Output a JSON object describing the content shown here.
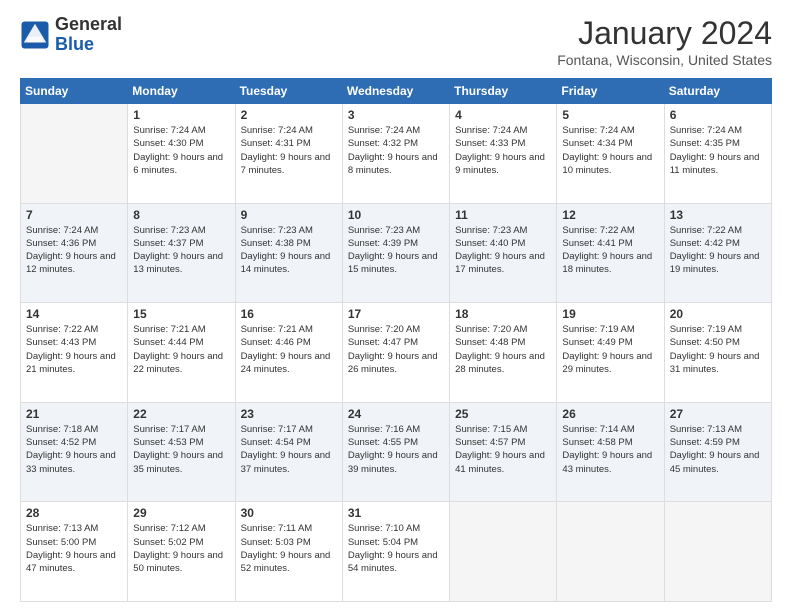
{
  "header": {
    "logo_general": "General",
    "logo_blue": "Blue",
    "month_title": "January 2024",
    "location": "Fontana, Wisconsin, United States"
  },
  "days_of_week": [
    "Sunday",
    "Monday",
    "Tuesday",
    "Wednesday",
    "Thursday",
    "Friday",
    "Saturday"
  ],
  "weeks": [
    {
      "shaded": false,
      "days": [
        {
          "num": "",
          "sunrise": "",
          "sunset": "",
          "daylight": ""
        },
        {
          "num": "1",
          "sunrise": "Sunrise: 7:24 AM",
          "sunset": "Sunset: 4:30 PM",
          "daylight": "Daylight: 9 hours and 6 minutes."
        },
        {
          "num": "2",
          "sunrise": "Sunrise: 7:24 AM",
          "sunset": "Sunset: 4:31 PM",
          "daylight": "Daylight: 9 hours and 7 minutes."
        },
        {
          "num": "3",
          "sunrise": "Sunrise: 7:24 AM",
          "sunset": "Sunset: 4:32 PM",
          "daylight": "Daylight: 9 hours and 8 minutes."
        },
        {
          "num": "4",
          "sunrise": "Sunrise: 7:24 AM",
          "sunset": "Sunset: 4:33 PM",
          "daylight": "Daylight: 9 hours and 9 minutes."
        },
        {
          "num": "5",
          "sunrise": "Sunrise: 7:24 AM",
          "sunset": "Sunset: 4:34 PM",
          "daylight": "Daylight: 9 hours and 10 minutes."
        },
        {
          "num": "6",
          "sunrise": "Sunrise: 7:24 AM",
          "sunset": "Sunset: 4:35 PM",
          "daylight": "Daylight: 9 hours and 11 minutes."
        }
      ]
    },
    {
      "shaded": true,
      "days": [
        {
          "num": "7",
          "sunrise": "Sunrise: 7:24 AM",
          "sunset": "Sunset: 4:36 PM",
          "daylight": "Daylight: 9 hours and 12 minutes."
        },
        {
          "num": "8",
          "sunrise": "Sunrise: 7:23 AM",
          "sunset": "Sunset: 4:37 PM",
          "daylight": "Daylight: 9 hours and 13 minutes."
        },
        {
          "num": "9",
          "sunrise": "Sunrise: 7:23 AM",
          "sunset": "Sunset: 4:38 PM",
          "daylight": "Daylight: 9 hours and 14 minutes."
        },
        {
          "num": "10",
          "sunrise": "Sunrise: 7:23 AM",
          "sunset": "Sunset: 4:39 PM",
          "daylight": "Daylight: 9 hours and 15 minutes."
        },
        {
          "num": "11",
          "sunrise": "Sunrise: 7:23 AM",
          "sunset": "Sunset: 4:40 PM",
          "daylight": "Daylight: 9 hours and 17 minutes."
        },
        {
          "num": "12",
          "sunrise": "Sunrise: 7:22 AM",
          "sunset": "Sunset: 4:41 PM",
          "daylight": "Daylight: 9 hours and 18 minutes."
        },
        {
          "num": "13",
          "sunrise": "Sunrise: 7:22 AM",
          "sunset": "Sunset: 4:42 PM",
          "daylight": "Daylight: 9 hours and 19 minutes."
        }
      ]
    },
    {
      "shaded": false,
      "days": [
        {
          "num": "14",
          "sunrise": "Sunrise: 7:22 AM",
          "sunset": "Sunset: 4:43 PM",
          "daylight": "Daylight: 9 hours and 21 minutes."
        },
        {
          "num": "15",
          "sunrise": "Sunrise: 7:21 AM",
          "sunset": "Sunset: 4:44 PM",
          "daylight": "Daylight: 9 hours and 22 minutes."
        },
        {
          "num": "16",
          "sunrise": "Sunrise: 7:21 AM",
          "sunset": "Sunset: 4:46 PM",
          "daylight": "Daylight: 9 hours and 24 minutes."
        },
        {
          "num": "17",
          "sunrise": "Sunrise: 7:20 AM",
          "sunset": "Sunset: 4:47 PM",
          "daylight": "Daylight: 9 hours and 26 minutes."
        },
        {
          "num": "18",
          "sunrise": "Sunrise: 7:20 AM",
          "sunset": "Sunset: 4:48 PM",
          "daylight": "Daylight: 9 hours and 28 minutes."
        },
        {
          "num": "19",
          "sunrise": "Sunrise: 7:19 AM",
          "sunset": "Sunset: 4:49 PM",
          "daylight": "Daylight: 9 hours and 29 minutes."
        },
        {
          "num": "20",
          "sunrise": "Sunrise: 7:19 AM",
          "sunset": "Sunset: 4:50 PM",
          "daylight": "Daylight: 9 hours and 31 minutes."
        }
      ]
    },
    {
      "shaded": true,
      "days": [
        {
          "num": "21",
          "sunrise": "Sunrise: 7:18 AM",
          "sunset": "Sunset: 4:52 PM",
          "daylight": "Daylight: 9 hours and 33 minutes."
        },
        {
          "num": "22",
          "sunrise": "Sunrise: 7:17 AM",
          "sunset": "Sunset: 4:53 PM",
          "daylight": "Daylight: 9 hours and 35 minutes."
        },
        {
          "num": "23",
          "sunrise": "Sunrise: 7:17 AM",
          "sunset": "Sunset: 4:54 PM",
          "daylight": "Daylight: 9 hours and 37 minutes."
        },
        {
          "num": "24",
          "sunrise": "Sunrise: 7:16 AM",
          "sunset": "Sunset: 4:55 PM",
          "daylight": "Daylight: 9 hours and 39 minutes."
        },
        {
          "num": "25",
          "sunrise": "Sunrise: 7:15 AM",
          "sunset": "Sunset: 4:57 PM",
          "daylight": "Daylight: 9 hours and 41 minutes."
        },
        {
          "num": "26",
          "sunrise": "Sunrise: 7:14 AM",
          "sunset": "Sunset: 4:58 PM",
          "daylight": "Daylight: 9 hours and 43 minutes."
        },
        {
          "num": "27",
          "sunrise": "Sunrise: 7:13 AM",
          "sunset": "Sunset: 4:59 PM",
          "daylight": "Daylight: 9 hours and 45 minutes."
        }
      ]
    },
    {
      "shaded": false,
      "days": [
        {
          "num": "28",
          "sunrise": "Sunrise: 7:13 AM",
          "sunset": "Sunset: 5:00 PM",
          "daylight": "Daylight: 9 hours and 47 minutes."
        },
        {
          "num": "29",
          "sunrise": "Sunrise: 7:12 AM",
          "sunset": "Sunset: 5:02 PM",
          "daylight": "Daylight: 9 hours and 50 minutes."
        },
        {
          "num": "30",
          "sunrise": "Sunrise: 7:11 AM",
          "sunset": "Sunset: 5:03 PM",
          "daylight": "Daylight: 9 hours and 52 minutes."
        },
        {
          "num": "31",
          "sunrise": "Sunrise: 7:10 AM",
          "sunset": "Sunset: 5:04 PM",
          "daylight": "Daylight: 9 hours and 54 minutes."
        },
        {
          "num": "",
          "sunrise": "",
          "sunset": "",
          "daylight": ""
        },
        {
          "num": "",
          "sunrise": "",
          "sunset": "",
          "daylight": ""
        },
        {
          "num": "",
          "sunrise": "",
          "sunset": "",
          "daylight": ""
        }
      ]
    }
  ]
}
